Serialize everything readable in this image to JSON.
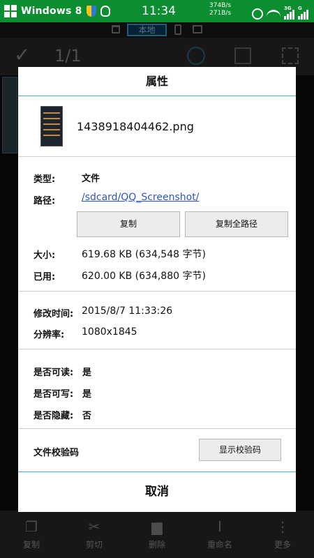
{
  "status_bar": {
    "os_label": "Windows 8",
    "time": "11:34",
    "speed_up": "374B/s",
    "speed_down": "271B/s",
    "network_3g": "3G",
    "network_g": "G"
  },
  "background": {
    "path_local_label": "本地",
    "selection_count": "1/1",
    "bottom_actions": [
      {
        "label": "复制",
        "icon": "copy-icon"
      },
      {
        "label": "剪切",
        "icon": "scissors-icon"
      },
      {
        "label": "删除",
        "icon": "trash-icon"
      },
      {
        "label": "重命名",
        "icon": "rename-icon"
      },
      {
        "label": "更多",
        "icon": "more-icon"
      }
    ]
  },
  "dialog": {
    "title": "属性",
    "file_name": "1438918404462.png",
    "type_label": "类型:",
    "type_value": "文件",
    "path_label": "路径:",
    "path_value": "/sdcard/QQ_Screenshot/",
    "copy_button": "复制",
    "copy_full_path_button": "复制全路径",
    "size_label": "大小:",
    "size_value": "619.68 KB (634,548 字节)",
    "used_label": "已用:",
    "used_value": "620.00 KB (634,880 字节)",
    "modified_label": "修改时间:",
    "modified_value": "2015/8/7 11:33:26",
    "resolution_label": "分辨率:",
    "resolution_value": "1080x1845",
    "readable_label": "是否可读:",
    "readable_value": "是",
    "writable_label": "是否可写:",
    "writable_value": "是",
    "hidden_label": "是否隐藏:",
    "hidden_value": "否",
    "checksum_label": "文件校验码",
    "checksum_button": "显示校验码",
    "cancel_button": "取消"
  }
}
